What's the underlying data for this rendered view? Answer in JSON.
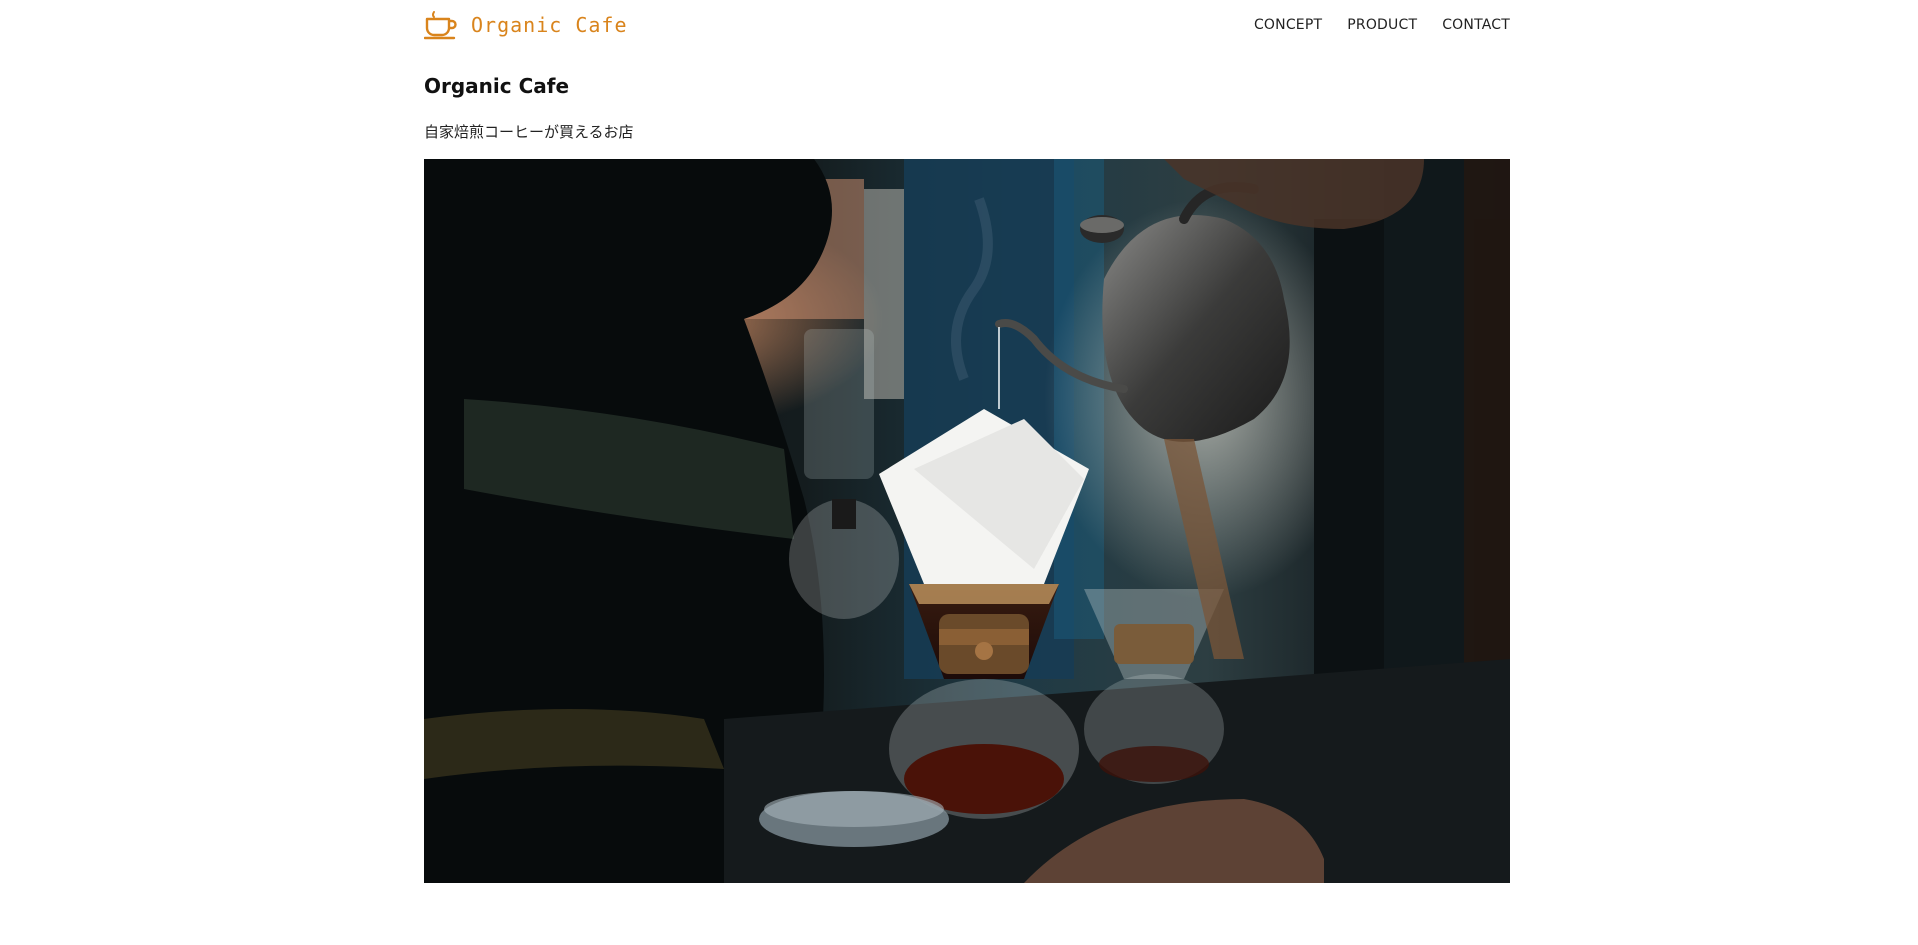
{
  "header": {
    "logo_text": "Organic Cafe",
    "logo_icon": "coffee-cup-icon",
    "nav": [
      {
        "label": "CONCEPT"
      },
      {
        "label": "PRODUCT"
      },
      {
        "label": "CONTACT"
      }
    ]
  },
  "main": {
    "title": "Organic Cafe",
    "tagline": "自家焙煎コーヒーが買えるお店"
  },
  "colors": {
    "brand": "#d9841c",
    "text": "#111111",
    "background": "#ffffff"
  }
}
